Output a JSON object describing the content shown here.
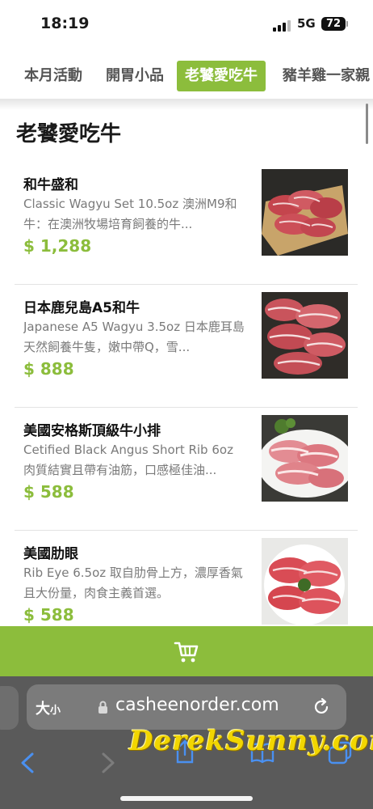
{
  "status_bar": {
    "time": "18:19",
    "network": "5G",
    "battery": "72"
  },
  "tabs": [
    {
      "label": "本月活動",
      "active": false
    },
    {
      "label": "開胃小品",
      "active": false
    },
    {
      "label": "老饕愛吃牛",
      "active": true
    },
    {
      "label": "豬羊雞一家親",
      "active": false
    }
  ],
  "section": {
    "title": "老饕愛吃牛"
  },
  "products": [
    {
      "name": "和牛盛和",
      "description": "Classic Wagyu Set 10.5oz 澳洲M9和牛：在澳洲牧場培育飼養的牛...",
      "price": "$ 1,288",
      "image_icon": "wagyu-platter-photo"
    },
    {
      "name": "日本鹿兒島A5和牛",
      "description": "Japanese A5 Wagyu 3.5oz 日本鹿耳島天然飼養牛隻，嫩中帶Q，雪...",
      "price": "$ 888",
      "image_icon": "a5-wagyu-slices-photo"
    },
    {
      "name": "美國安格斯頂級牛小排",
      "description": "Cetified Black Angus Short Rib 6oz 肉質結實且帶有油筋，口感極佳油...",
      "price": "$ 588",
      "image_icon": "short-rib-slices-photo"
    },
    {
      "name": "美國肋眼",
      "description": "Rib Eye 6.5oz 取自肋骨上方，濃厚香氣且大份量，肉食主義首選。",
      "price": "$ 588",
      "image_icon": "rib-eye-slices-photo"
    }
  ],
  "cart": {
    "icon": "cart-icon"
  },
  "browser": {
    "text_size_label": "大",
    "text_size_small": "小",
    "url": "casheenorder.com"
  },
  "watermark": "DerekSunny.com",
  "colors": {
    "accent": "#8cbd3c",
    "price": "#8cbd3c",
    "browser_bg": "#5a5a5a",
    "watermark": "#f2d600"
  }
}
